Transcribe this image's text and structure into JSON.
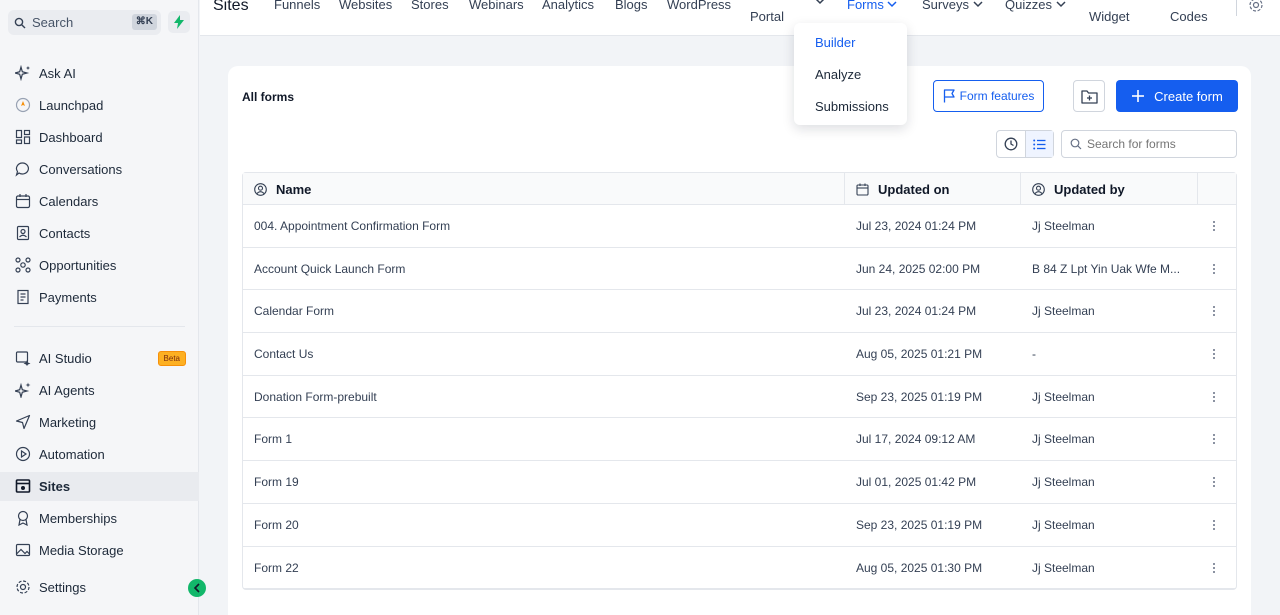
{
  "sidebar": {
    "search_label": "Search",
    "search_shortcut": "⌘K",
    "items": [
      {
        "label": "Ask AI",
        "icon": "sparkles-icon"
      },
      {
        "label": "Launchpad",
        "icon": "launchpad-icon"
      },
      {
        "label": "Dashboard",
        "icon": "dashboard-icon"
      },
      {
        "label": "Conversations",
        "icon": "chat-icon"
      },
      {
        "label": "Calendars",
        "icon": "calendar-icon"
      },
      {
        "label": "Contacts",
        "icon": "contacts-icon"
      },
      {
        "label": "Opportunities",
        "icon": "opportunities-icon"
      },
      {
        "label": "Payments",
        "icon": "payments-icon"
      },
      {
        "label": "AI Studio",
        "icon": "ai-studio-icon",
        "badge": "Beta"
      },
      {
        "label": "AI Agents",
        "icon": "ai-agents-icon"
      },
      {
        "label": "Marketing",
        "icon": "send-icon"
      },
      {
        "label": "Automation",
        "icon": "automation-icon"
      },
      {
        "label": "Sites",
        "icon": "sites-icon",
        "active": true
      },
      {
        "label": "Memberships",
        "icon": "award-icon"
      },
      {
        "label": "Media Storage",
        "icon": "media-icon"
      },
      {
        "label": "Settings",
        "icon": "gear-icon"
      }
    ]
  },
  "topnav": {
    "title": "Sites",
    "tabs": [
      "Funnels",
      "Websites",
      "Stores",
      "Webinars",
      "Analytics",
      "Blogs",
      "WordPress",
      "Portal",
      "Forms",
      "Surveys",
      "Quizzes",
      "Widget",
      "Codes"
    ],
    "active_tab": "Forms"
  },
  "forms_menu": {
    "items": [
      "Builder",
      "Analyze",
      "Submissions"
    ],
    "selected": "Builder"
  },
  "main": {
    "title": "All forms",
    "form_features_label": "Form features",
    "create_form_label": "Create form",
    "search_placeholder": "Search for forms",
    "columns": [
      "Name",
      "Updated on",
      "Updated by"
    ],
    "rows": [
      {
        "name": "004. Appointment Confirmation Form",
        "updated_on": "Jul 23, 2024 01:24 PM",
        "updated_by": "Jj Steelman"
      },
      {
        "name": "Account Quick Launch Form",
        "updated_on": "Jun 24, 2025 02:00 PM",
        "updated_by": "B 84 Z Lpt Yin Uak Wfe M..."
      },
      {
        "name": "Calendar Form",
        "updated_on": "Jul 23, 2024 01:24 PM",
        "updated_by": "Jj Steelman"
      },
      {
        "name": "Contact Us",
        "updated_on": "Aug 05, 2025 01:21 PM",
        "updated_by": "-"
      },
      {
        "name": "Donation Form-prebuilt",
        "updated_on": "Sep 23, 2025 01:19 PM",
        "updated_by": "Jj Steelman"
      },
      {
        "name": "Form 1",
        "updated_on": "Jul 17, 2024 09:12 AM",
        "updated_by": "Jj Steelman"
      },
      {
        "name": "Form 19",
        "updated_on": "Jul 01, 2025 01:42 PM",
        "updated_by": "Jj Steelman"
      },
      {
        "name": "Form 20",
        "updated_on": "Sep 23, 2025 01:19 PM",
        "updated_by": "Jj Steelman"
      },
      {
        "name": "Form 22",
        "updated_on": "Aug 05, 2025 01:30 PM",
        "updated_by": "Jj Steelman"
      }
    ]
  },
  "colors": {
    "accent": "#155eef",
    "success": "#12b76a",
    "beta": "#fdb022"
  }
}
